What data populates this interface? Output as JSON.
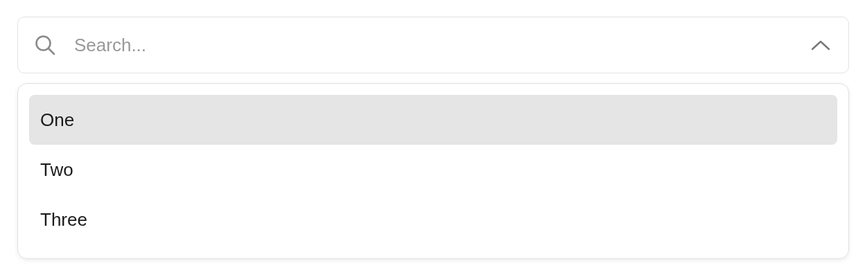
{
  "search": {
    "placeholder": "Search...",
    "expanded": true
  },
  "options": [
    {
      "label": "One",
      "selected": true
    },
    {
      "label": "Two",
      "selected": false
    },
    {
      "label": "Three",
      "selected": false
    }
  ]
}
